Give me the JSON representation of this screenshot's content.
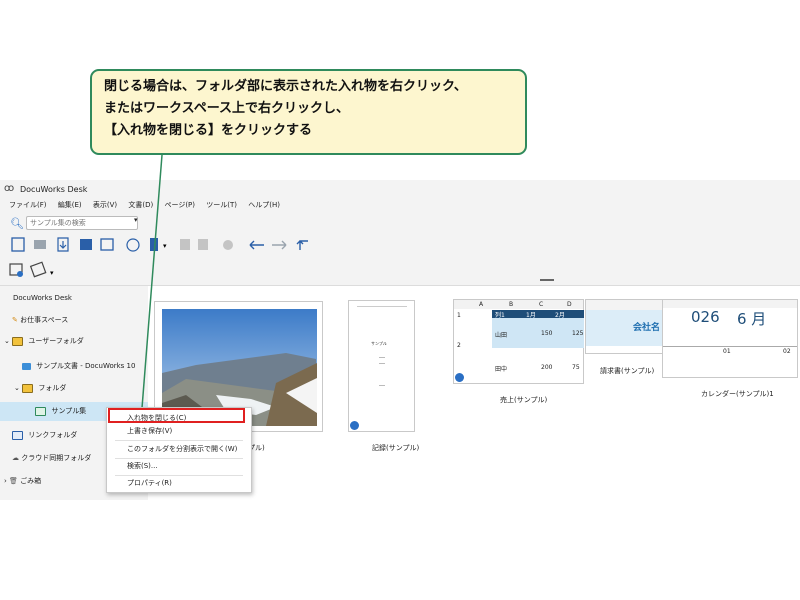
{
  "callout": {
    "lines": [
      "閉じる場合は、フォルダ部に表示された入れ物を右クリック、",
      "またはワークスペース上で右クリックし、",
      "【入れ物を閉じる】をクリックする"
    ]
  },
  "window": {
    "title": "DocuWorks Desk",
    "menu": [
      "ファイル(F)",
      "編集(E)",
      "表示(V)",
      "文書(D)",
      "ページ(P)",
      "ツール(T)",
      "ヘルプ(H)"
    ],
    "search_placeholder": "サンプル集の検索"
  },
  "sidebar": {
    "root": "DocuWorks Desk",
    "items": [
      {
        "label": "お仕事スペース"
      },
      {
        "label": "ユーザーフォルダ"
      },
      {
        "label": "サンプル文書 - DocuWorks 10"
      },
      {
        "label": "フォルダ"
      },
      {
        "label": "サンプル集"
      },
      {
        "label": "リンクフォルダ"
      },
      {
        "label": "クラウド同期フォルダ"
      },
      {
        "label": "ごみ箱"
      }
    ]
  },
  "context_menu": {
    "items": [
      "入れ物を閉じる(C)",
      "上書き保存(V)",
      "このフォルダを分割表示で開く(W)",
      "検索(S)...",
      "プロパティ(R)"
    ]
  },
  "workspace": {
    "captions": [
      "記録(サンプル)",
      "売上(サンプル)",
      "請求書(サンプル)",
      "カレンダー(サンプル)1"
    ],
    "photo_caption_tail": "プル)",
    "record_doc": {
      "title": "サンプル"
    },
    "sales": {
      "col_headers": [
        "A",
        "B",
        "C",
        "D"
      ],
      "row_headers": [
        "1",
        "2"
      ],
      "header_cells": [
        "列1",
        "1月",
        "2月"
      ],
      "rows": [
        {
          "name": "山田",
          "jan": "150",
          "feb": "125"
        },
        {
          "name": "田中",
          "jan": "200",
          "feb": "75"
        }
      ]
    },
    "invoice": {
      "company": "会社名"
    },
    "calendar": {
      "year_part": "026",
      "month": "6 月",
      "days": [
        "01",
        "02"
      ]
    }
  },
  "colors": {
    "accent_green": "#2f8a5c",
    "highlight_red": "#e02020",
    "callout_bg": "#fdf6cf",
    "sales_header": "#1f4e79",
    "sales_fill": "#cfe6f5"
  }
}
